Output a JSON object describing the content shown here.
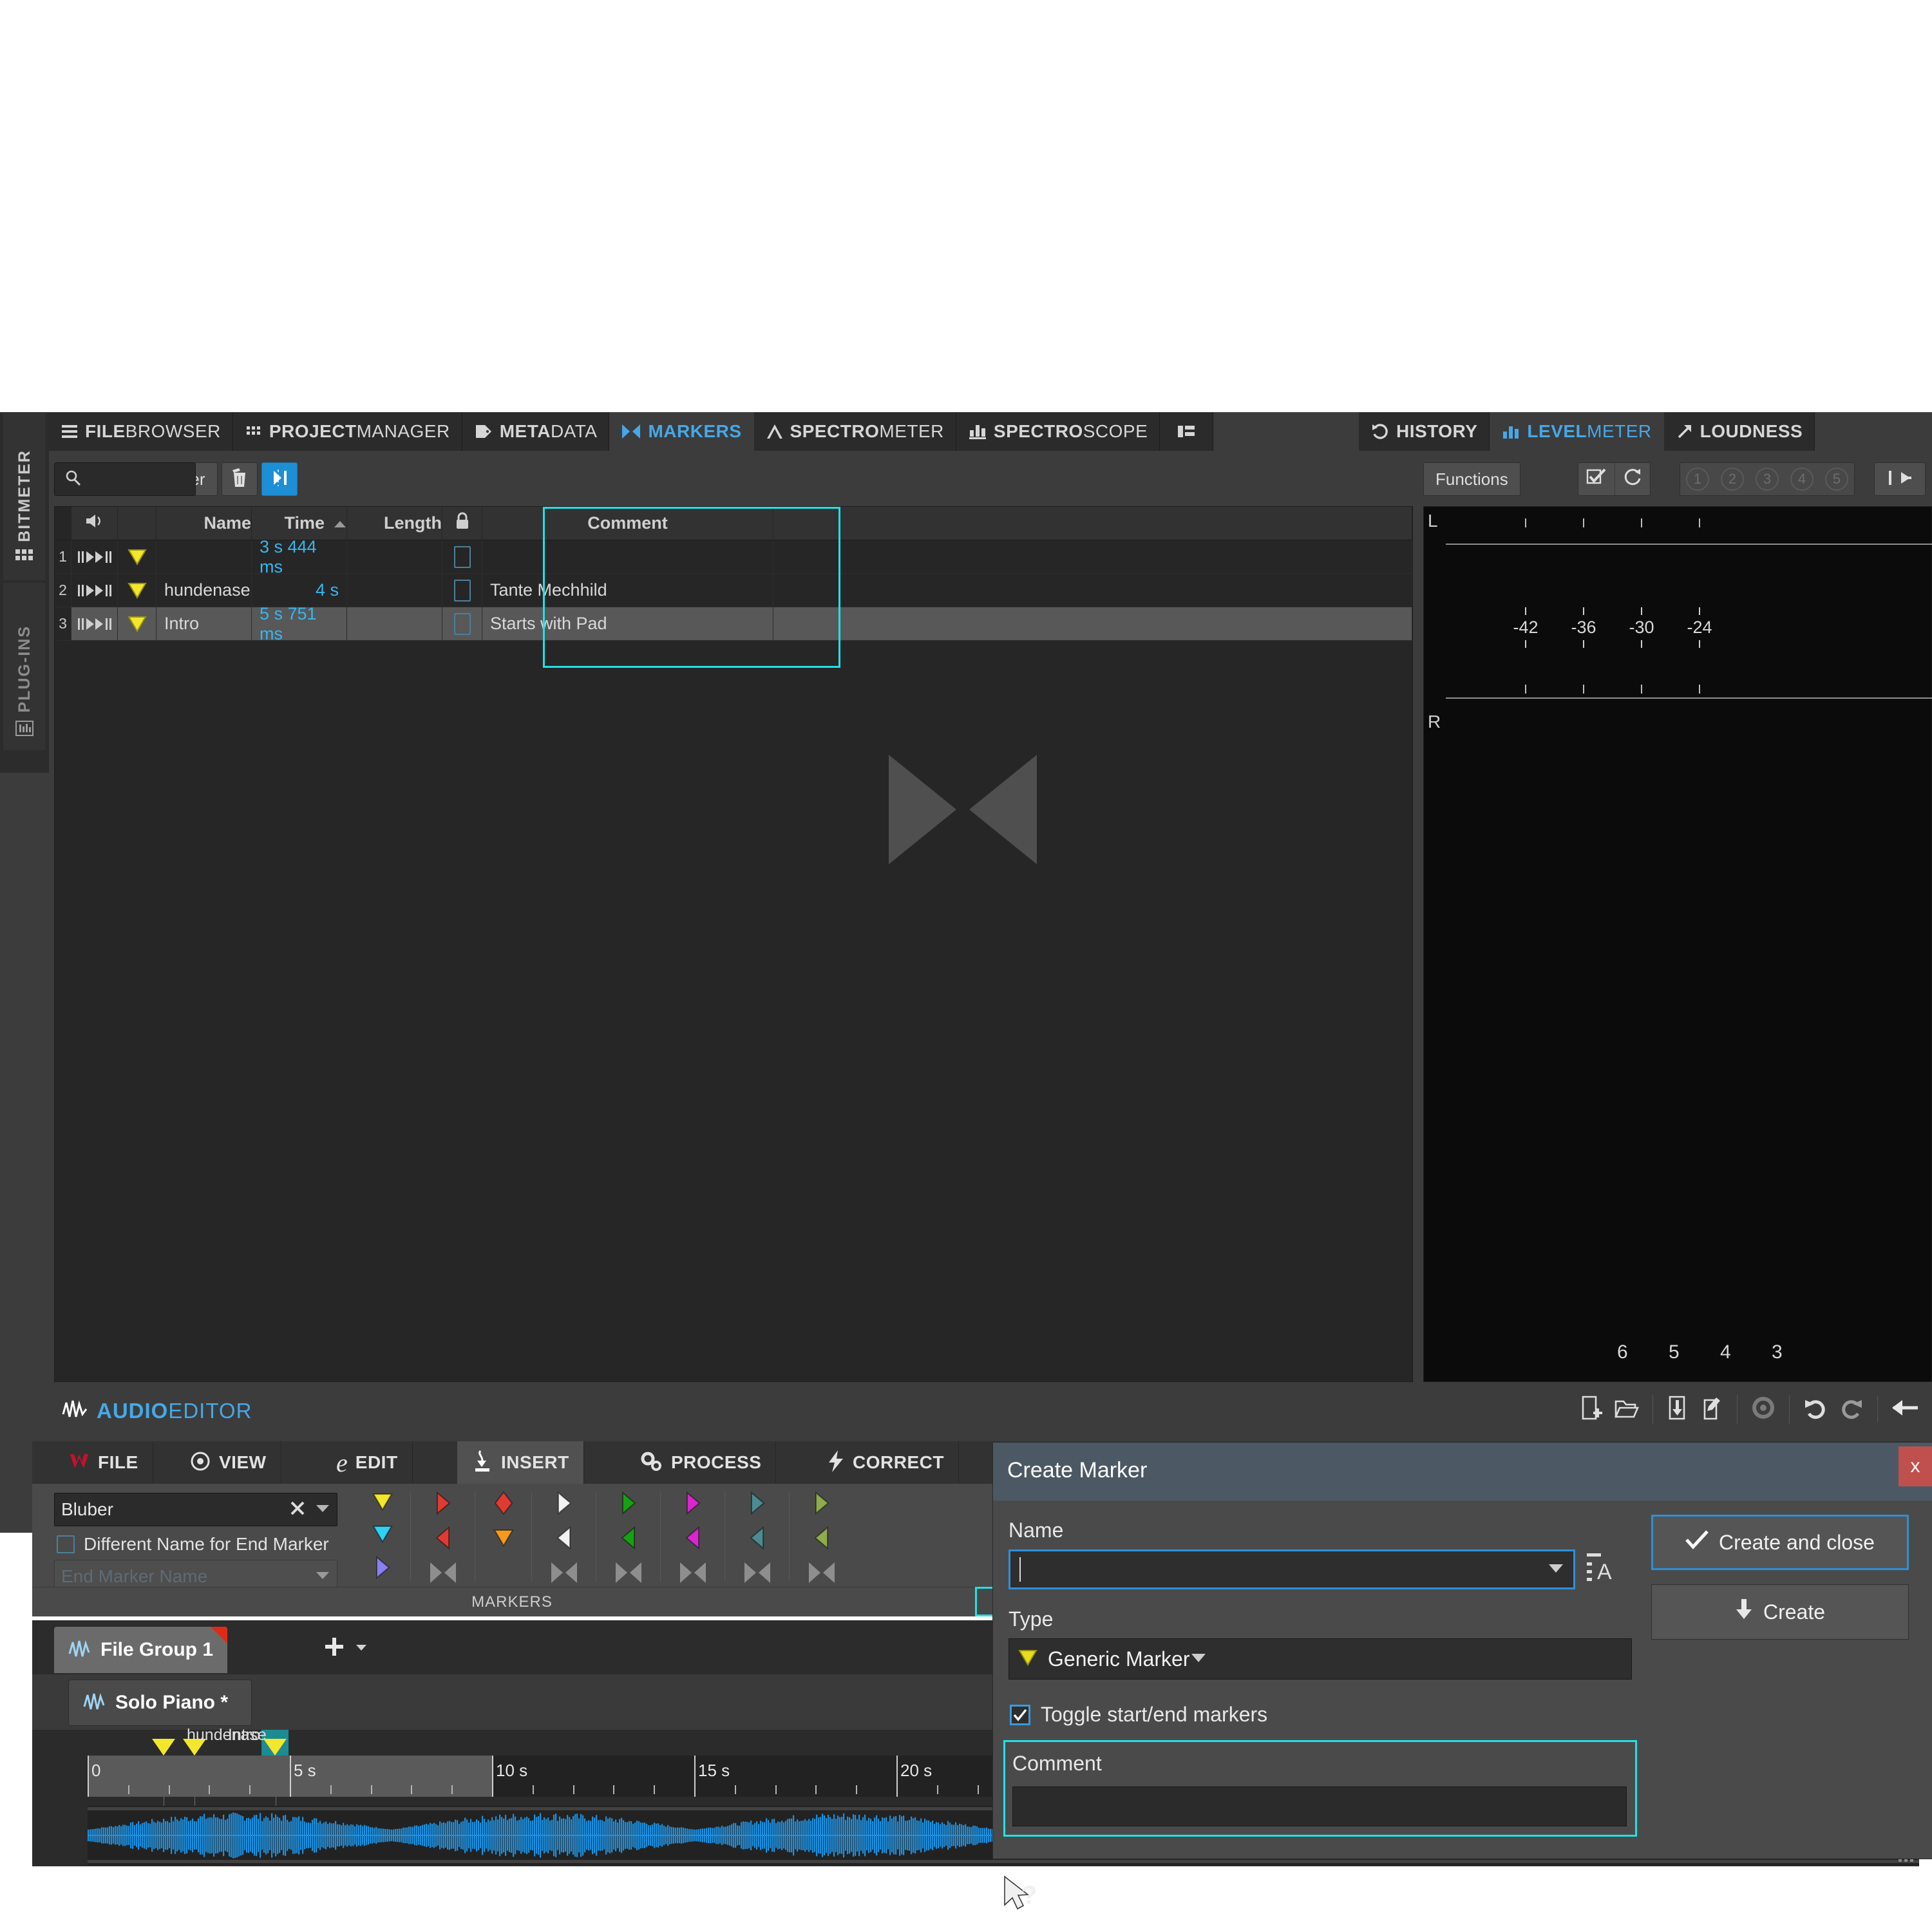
{
  "left_rail": {
    "items": [
      {
        "label": "BITMETER",
        "icon": "grid-icon",
        "active": true
      },
      {
        "label": "PLUG-INS",
        "icon": "plugins-icon",
        "active": false
      }
    ]
  },
  "top_tabs": {
    "left_group": [
      {
        "bold": "FILE",
        "light": "BROWSER",
        "icon": "hamburger-icon",
        "active": false
      },
      {
        "bold": "PROJECT",
        "light": "MANAGER",
        "icon": "grid-dots-icon",
        "active": false
      },
      {
        "bold": "META",
        "light": "DATA",
        "icon": "tag-icon",
        "active": false
      },
      {
        "bold": "MARKERS",
        "light": "",
        "icon": "markers-icon",
        "active": true
      },
      {
        "bold": "SPECTRO",
        "light": "METER",
        "icon": "peak-icon",
        "active": false
      },
      {
        "bold": "SPECTRO",
        "light": "SCOPE",
        "icon": "bars-icon",
        "active": false
      }
    ],
    "left_group_extra_icon": "layout-list-icon",
    "right_group": [
      {
        "bold": "HISTORY",
        "light": "",
        "icon": "undo-icon",
        "active": false
      },
      {
        "bold": "LEVEL",
        "light": "METER",
        "icon": "bars-icon",
        "active": true
      },
      {
        "bold": "LOUDNESS",
        "light": "",
        "icon": "arrow-up-right-icon",
        "active": false
      }
    ]
  },
  "markers_panel": {
    "toolbar": {
      "functions_label": "Functions",
      "filter_label": "Filter",
      "delete_icon": "trash-icon",
      "goto_icon": "goto-marker-icon",
      "search_icon": "search-icon",
      "search_value": "",
      "search_placeholder": ""
    },
    "columns": [
      "",
      "speaker-icon",
      "",
      "Name",
      "Time",
      "Length",
      "lock-icon",
      "Comment",
      ""
    ],
    "headers": {
      "name": "Name",
      "time": "Time",
      "length": "Length",
      "comment": "Comment",
      "sort_indicator": "ascending"
    },
    "rows": [
      {
        "num": "1",
        "name": "",
        "time": "3 s 444 ms",
        "length": "",
        "comment": "",
        "selected": false,
        "flag_color": "#f2e72a"
      },
      {
        "num": "2",
        "name": "hundenase",
        "time": "4 s",
        "length": "",
        "comment": "Tante Mechhild",
        "selected": false,
        "flag_color": "#f2e72a"
      },
      {
        "num": "3",
        "name": "Intro",
        "time": "5 s 751 ms",
        "length": "",
        "comment": "Starts with Pad",
        "selected": true,
        "flag_color": "#f2e72a"
      }
    ]
  },
  "level_meter": {
    "toolbar": {
      "functions_label": "Functions",
      "check_icon": "checkbox-pen-icon",
      "reset_icon": "reset-icon",
      "presets": [
        "1",
        "2",
        "3",
        "4",
        "5"
      ],
      "reset_peak_icon": "reset-peak-icon"
    },
    "channels": [
      "L",
      "R"
    ],
    "db_ticks": [
      "-42",
      "-36",
      "-30",
      "-24"
    ],
    "bottom_ticks": [
      "6",
      "5",
      "4",
      "3"
    ]
  },
  "audio_editor": {
    "title_bold": "AUDIO",
    "title_light": "EDITOR",
    "title_icon": "waveform-icon",
    "top_icons": [
      {
        "name": "new-file-icon"
      },
      {
        "name": "open-folder-icon"
      },
      {
        "name": "save-icon"
      },
      {
        "name": "save-as-icon"
      },
      {
        "name": "revert-icon"
      },
      {
        "name": "undo-icon"
      },
      {
        "name": "redo-icon"
      },
      {
        "name": "back-arrow-icon"
      }
    ],
    "menubar": [
      {
        "label": "FILE",
        "icon": "wavelab-logo-icon",
        "active": false
      },
      {
        "label": "VIEW",
        "icon": "eye-icon",
        "active": false
      },
      {
        "label": "EDIT",
        "icon": "e-icon",
        "active": false
      },
      {
        "label": "INSERT",
        "icon": "insert-icon",
        "active": true
      },
      {
        "label": "PROCESS",
        "icon": "gears-icon",
        "active": false
      },
      {
        "label": "CORRECT",
        "icon": "bolt-icon",
        "active": false
      }
    ],
    "insert_panel": {
      "marker_name_value": "Bluber",
      "marker_name_clear_icon": "clear-x-icon",
      "marker_name_dropdown_icon": "chevron-down-icon",
      "different_name_label": "Different Name for End Marker",
      "different_name_checked": false,
      "end_marker_placeholder": "End Marker Name",
      "end_marker_value": "",
      "markers_section_label": "MARKERS",
      "popout_icon": "popout-icon",
      "marker_icons": [
        {
          "name": "generic-marker-down-yellow",
          "color": "#f2e72a",
          "shape": "down"
        },
        {
          "name": "generic-marker-down-cyan",
          "color": "#2fd2f5",
          "shape": "down"
        },
        {
          "name": "generic-marker-right-blue",
          "color": "#8a7ef0",
          "shape": "right"
        },
        {
          "name": "region-start-red",
          "color": "#e03b32",
          "shape": "right"
        },
        {
          "name": "region-end-red",
          "color": "#e03b32",
          "shape": "left"
        },
        {
          "name": "region-pair-gray",
          "color": "#8e8e8e",
          "shape": "pair"
        },
        {
          "name": "cd-track-marker-red",
          "color": "#e03b32",
          "shape": "diamond"
        },
        {
          "name": "cd-track-end-orange",
          "color": "#f59a1e",
          "shape": "down"
        },
        {
          "name": "loop-start-white",
          "color": "#f2f2f2",
          "shape": "right"
        },
        {
          "name": "loop-end-white",
          "color": "#f2f2f2",
          "shape": "left"
        },
        {
          "name": "loop-pair-gray",
          "color": "#8e8e8e",
          "shape": "pair"
        },
        {
          "name": "mute-start-green",
          "color": "#17a013",
          "shape": "right"
        },
        {
          "name": "mute-end-green",
          "color": "#17a013",
          "shape": "left"
        },
        {
          "name": "mute-pair-gray",
          "color": "#8e8e8e",
          "shape": "pair"
        },
        {
          "name": "playback-start-magenta",
          "color": "#d827cf",
          "shape": "right"
        },
        {
          "name": "playback-end-magenta",
          "color": "#d827cf",
          "shape": "left"
        },
        {
          "name": "playback-pair-gray",
          "color": "#8e8e8e",
          "shape": "pair"
        },
        {
          "name": "section-start-teal",
          "color": "#4b8c92",
          "shape": "right"
        },
        {
          "name": "section-end-teal",
          "color": "#4b8c92",
          "shape": "left"
        },
        {
          "name": "section-pair-gray",
          "color": "#8e8e8e",
          "shape": "pair"
        },
        {
          "name": "custom-start-olive",
          "color": "#8fab4c",
          "shape": "right"
        },
        {
          "name": "custom-end-olive",
          "color": "#8fab4c",
          "shape": "left"
        },
        {
          "name": "custom-pair-gray",
          "color": "#8e8e8e",
          "shape": "pair"
        }
      ]
    },
    "file_group_tab": {
      "label": "File Group 1",
      "icon": "waveform-icon",
      "modified": true
    },
    "add_tab_icon": "plus-icon",
    "add_tab_dropdown_icon": "chevron-down-small-icon",
    "file_tab": {
      "label": "Solo Piano *",
      "icon": "waveform-icon",
      "modified": true
    },
    "timeline": {
      "labels": [
        "0",
        "5 s",
        "10 s",
        "15 s",
        "20 s"
      ],
      "marker_labels": [
        "hundenase",
        "Intro"
      ],
      "marker_positions_s": [
        3.444,
        4.0,
        5.751
      ]
    }
  },
  "create_marker_dialog": {
    "title": "Create Marker",
    "close_label": "x",
    "name_label": "Name",
    "name_value": "",
    "name_dropdown_icon": "chevron-down-icon",
    "name_list_icon": "text-list-icon",
    "type_label": "Type",
    "type_value": "Generic Marker",
    "type_icon": "generic-marker-icon",
    "type_dropdown_icon": "chevron-down-icon",
    "toggle_label": "Toggle start/end markers",
    "toggle_checked": true,
    "comment_label": "Comment",
    "comment_value": "",
    "buttons": {
      "create_and_close": "Create and close",
      "create_and_close_icon": "check-icon",
      "create": "Create",
      "create_icon": "down-arrow-icon"
    }
  },
  "cursor": {
    "icon": "pointer-help-icon"
  }
}
